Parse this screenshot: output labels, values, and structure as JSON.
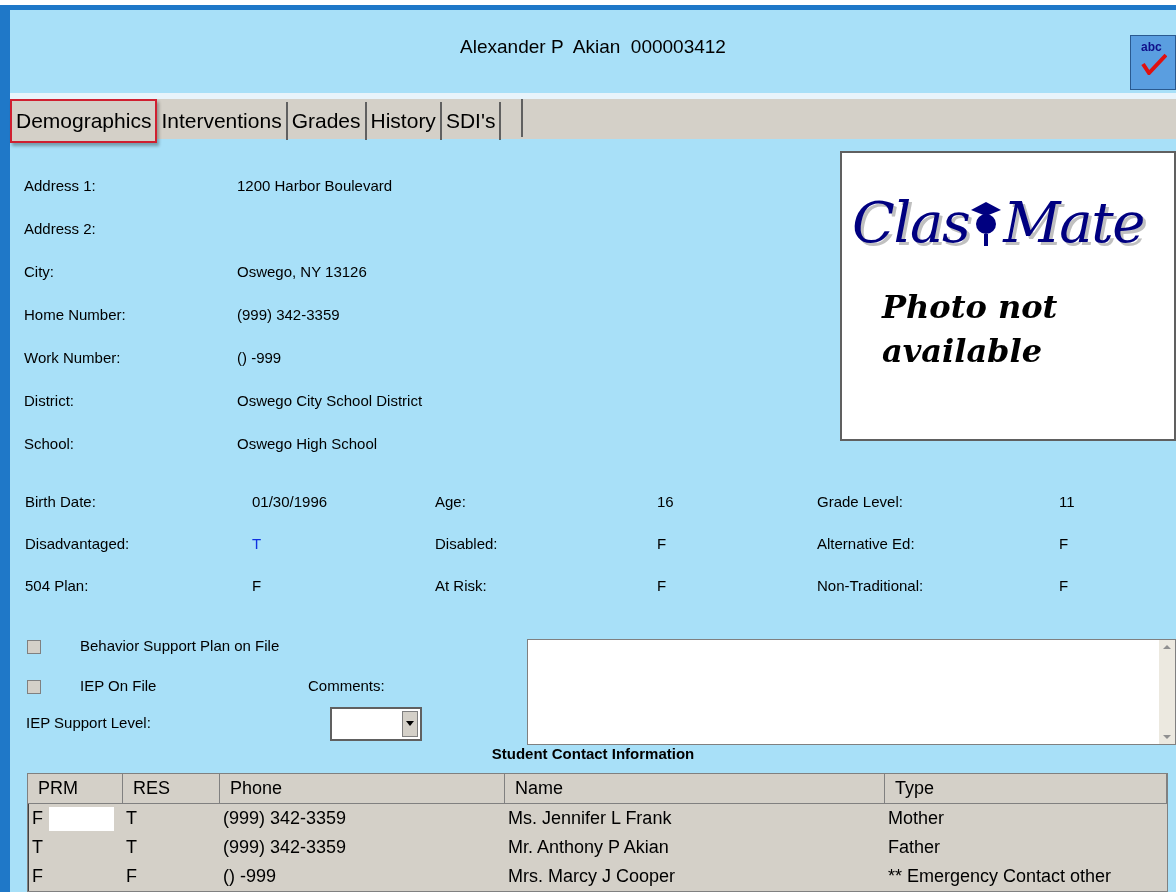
{
  "header": {
    "title": "Alexander P  Akian  000003412",
    "spellcheck_label": "abc"
  },
  "tabs": [
    {
      "label": "Demographics",
      "selected": true
    },
    {
      "label": "Interventions",
      "selected": false
    },
    {
      "label": "Grades",
      "selected": false
    },
    {
      "label": "History",
      "selected": false
    },
    {
      "label": "SDI's",
      "selected": false
    }
  ],
  "fields": [
    {
      "label": "Address 1:",
      "value": "1200 Harbor Boulevard"
    },
    {
      "label": "Address 2:"
    },
    {
      "label": "City:",
      "value": "Oswego, NY 13126"
    },
    {
      "label": "Home Number:",
      "value": "(999) 342-3359"
    },
    {
      "label": "Work Number:",
      "value": "() -999"
    },
    {
      "label": "District:",
      "value": "Oswego City School District"
    },
    {
      "label": "School:",
      "value": "Oswego High School"
    }
  ],
  "photo": {
    "logo_left": "Clas",
    "logo_right": "Mate",
    "note": "Photo not available"
  },
  "flag_rows": [
    [
      {
        "label": "Birth Date:",
        "value": "01/30/1996",
        "emphasis": false
      },
      {
        "label": "Age:",
        "value": "16",
        "emphasis": false
      },
      {
        "label": "Grade Level:",
        "value": "11",
        "emphasis": false
      }
    ],
    [
      {
        "label": "Disadvantaged:",
        "value": "T",
        "emphasis": true
      },
      {
        "label": "Disabled:",
        "value": "F",
        "emphasis": false
      },
      {
        "label": "Alternative Ed:",
        "value": "F",
        "emphasis": false
      }
    ],
    [
      {
        "label": "504 Plan:",
        "value": "F",
        "emphasis": false
      },
      {
        "label": "At Risk:",
        "value": "F",
        "emphasis": false
      },
      {
        "label": "Non-Traditional:",
        "value": "F",
        "emphasis": false
      }
    ]
  ],
  "checkboxes": [
    {
      "label": "Behavior Support Plan on File",
      "checked": false
    },
    {
      "label": "IEP On File",
      "checked": false
    }
  ],
  "support_level": {
    "label": "IEP Support Level:"
  },
  "comments": {
    "label": "Comments:"
  },
  "contacts": {
    "title": "Student Contact Information",
    "columns": [
      "PRM",
      "RES",
      "Phone",
      "Name",
      "Type"
    ],
    "rows": [
      {
        "cells": [
          "F",
          "T",
          "(999) 342-3359",
          "Ms. Jennifer L Frank",
          "Mother"
        ],
        "editing": true
      },
      {
        "cells": [
          "T",
          "T",
          "(999) 342-3359",
          "Mr. Anthony P Akian",
          "Father"
        ],
        "editing": false
      },
      {
        "cells": [
          "F",
          "F",
          "() -999",
          "Mrs. Marcy J Cooper",
          "** Emergency Contact other"
        ],
        "editing": false
      }
    ]
  }
}
